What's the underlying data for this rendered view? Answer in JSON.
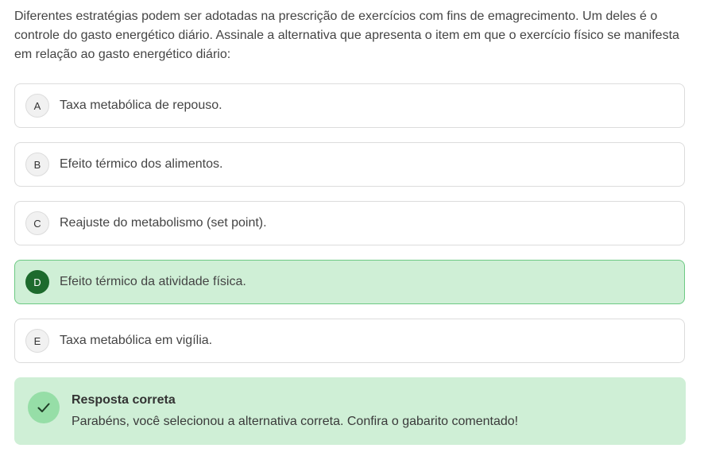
{
  "question": {
    "text": "Diferentes estratégias podem ser adotadas na prescrição de exercícios com fins de emagrecimento. Um deles é o controle do gasto energético diário. Assinale a alternativa que apresenta o item em que o exercício físico se manifesta em relação ao gasto energético diário:"
  },
  "options": [
    {
      "letter": "A",
      "text": "Taxa metabólica de repouso."
    },
    {
      "letter": "B",
      "text": "Efeito térmico dos alimentos."
    },
    {
      "letter": "C",
      "text": "Reajuste do metabolismo (set point)."
    },
    {
      "letter": "D",
      "text": "Efeito térmico da atividade física."
    },
    {
      "letter": "E",
      "text": "Taxa metabólica em vigília."
    }
  ],
  "selected_option": "D",
  "feedback": {
    "icon": "check-icon",
    "title": "Resposta correta",
    "message": "Parabéns, você selecionou a alternativa correta. Confira o gabarito comentado!"
  },
  "colors": {
    "selected_bg": "#cfefd6",
    "selected_border": "#6cc983",
    "selected_letter_bg": "#1d6a2d",
    "feedback_bg": "#cfefd6",
    "check_circle": "#96dea7"
  }
}
